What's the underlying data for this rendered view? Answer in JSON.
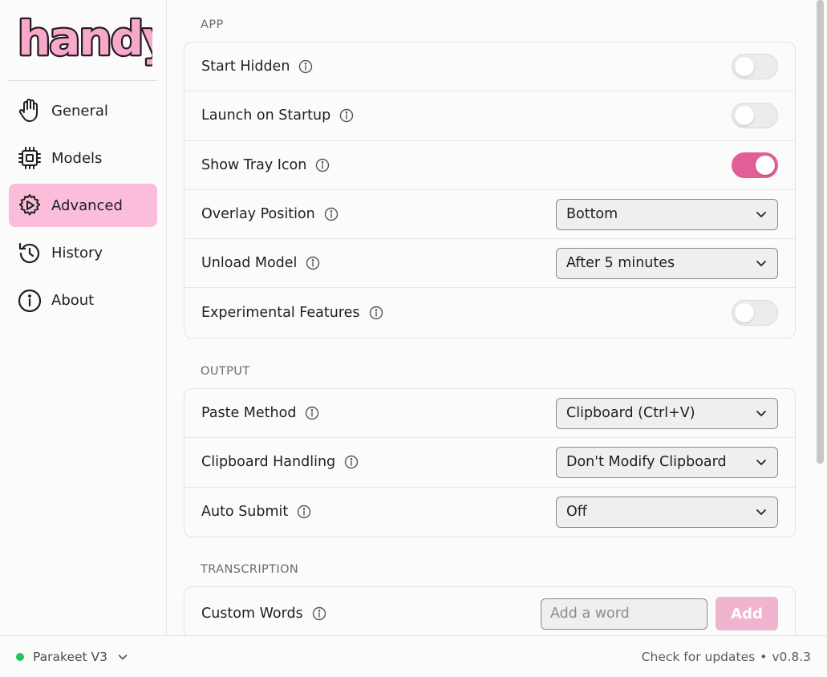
{
  "app": {
    "logo_text": "handy",
    "accent_color": "#df5f96",
    "accent_light": "#fbbdd9"
  },
  "sidebar": {
    "items": [
      {
        "label": "General",
        "icon": "hand-icon",
        "active": false
      },
      {
        "label": "Models",
        "icon": "chip-icon",
        "active": false
      },
      {
        "label": "Advanced",
        "icon": "gear-play-icon",
        "active": true
      },
      {
        "label": "History",
        "icon": "history-icon",
        "active": false
      },
      {
        "label": "About",
        "icon": "info-icon",
        "active": false
      }
    ]
  },
  "sections": {
    "app": {
      "title": "APP",
      "rows": {
        "start_hidden": {
          "label": "Start Hidden",
          "enabled": false
        },
        "launch_on_startup": {
          "label": "Launch on Startup",
          "enabled": false
        },
        "show_tray_icon": {
          "label": "Show Tray Icon",
          "enabled": true
        },
        "overlay_position": {
          "label": "Overlay Position",
          "value": "Bottom"
        },
        "unload_model": {
          "label": "Unload Model",
          "value": "After 5 minutes"
        },
        "experimental_features": {
          "label": "Experimental Features",
          "enabled": false
        }
      }
    },
    "output": {
      "title": "OUTPUT",
      "rows": {
        "paste_method": {
          "label": "Paste Method",
          "value": "Clipboard (Ctrl+V)"
        },
        "clipboard_handling": {
          "label": "Clipboard Handling",
          "value": "Don't Modify Clipboard"
        },
        "auto_submit": {
          "label": "Auto Submit",
          "value": "Off"
        }
      }
    },
    "transcription": {
      "title": "TRANSCRIPTION",
      "rows": {
        "custom_words": {
          "label": "Custom Words",
          "placeholder": "Add a word",
          "button_label": "Add"
        }
      }
    }
  },
  "footer": {
    "model_name": "Parakeet V3",
    "status_color": "#1ec85a",
    "check_updates": "Check for updates",
    "separator": "•",
    "version": "v0.8.3"
  }
}
